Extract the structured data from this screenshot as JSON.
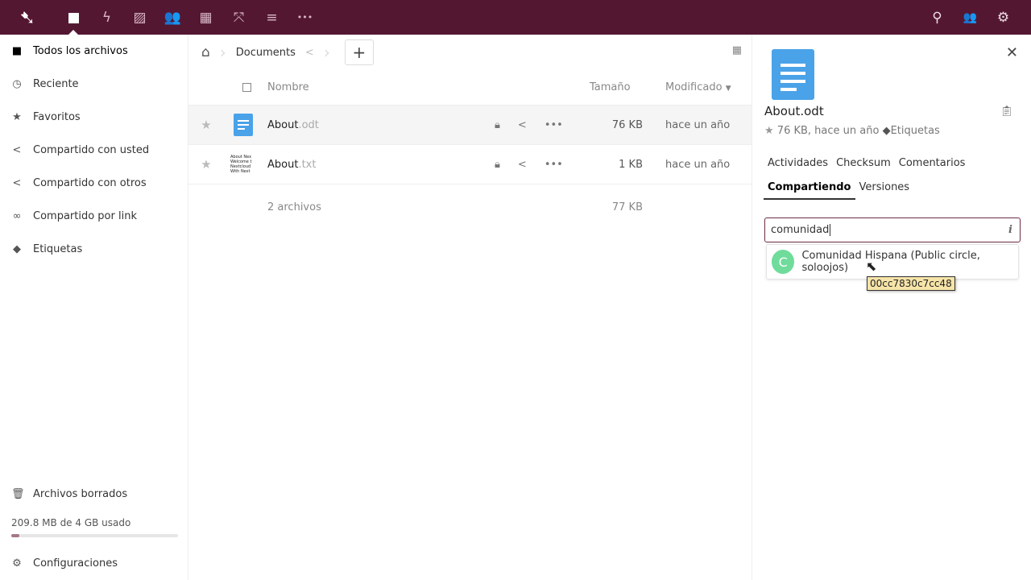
{
  "topbar": {
    "apps": [
      {
        "name": "files",
        "icon": "■"
      },
      {
        "name": "activity",
        "icon": "ϟ"
      },
      {
        "name": "gallery",
        "icon": "▨"
      },
      {
        "name": "contacts",
        "icon": "👥"
      },
      {
        "name": "calendar",
        "icon": "▦"
      },
      {
        "name": "circles",
        "icon": "⤧"
      },
      {
        "name": "notes",
        "icon": "≡"
      },
      {
        "name": "more",
        "icon": "•••"
      }
    ],
    "right": [
      {
        "name": "search",
        "icon": "⚲"
      },
      {
        "name": "contacts-menu",
        "icon": "👥"
      },
      {
        "name": "settings",
        "icon": "⚙"
      }
    ]
  },
  "sidebar": {
    "items": [
      {
        "label": "Todos los archivos",
        "icon": "■"
      },
      {
        "label": "Reciente",
        "icon": "◷"
      },
      {
        "label": "Favoritos",
        "icon": "★"
      },
      {
        "label": "Compartido con usted",
        "icon": "<"
      },
      {
        "label": "Compartido con otros",
        "icon": "<"
      },
      {
        "label": "Compartido por link",
        "icon": "∞"
      },
      {
        "label": "Etiquetas",
        "icon": "◆"
      }
    ],
    "deleted": "Archivos borrados",
    "quota": "209.8 MB de 4 GB usado",
    "quota_percent": 5,
    "settings": "Configuraciones"
  },
  "breadcrumb": {
    "home": "⌂",
    "folder": "Documents"
  },
  "table": {
    "headers": {
      "name": "Nombre",
      "size": "Tamaño",
      "modified": "Modificado"
    },
    "rows": [
      {
        "name": "About",
        "ext": ".odt",
        "size": "76 KB",
        "modified": "hace un año",
        "thumb_lines": []
      },
      {
        "name": "About",
        "ext": ".txt",
        "size": "1 KB",
        "modified": "hace un año",
        "thumb_lines": [
          "About Nex",
          "Welcome t",
          "Nextcloud",
          "With Next"
        ]
      }
    ],
    "summary": {
      "count": "2 archivos",
      "size": "77 KB"
    }
  },
  "details": {
    "filename": "About.odt",
    "meta": "76 KB, hace un año",
    "tags": "Etiquetas",
    "tabs": [
      "Actividades",
      "Checksum",
      "Comentarios",
      "Compartiendo",
      "Versiones"
    ],
    "active_tab": "Compartiendo",
    "share_input": "comunidad",
    "suggestion": {
      "initial": "C",
      "label": "Comunidad Hispana (Public circle, soloojos)"
    },
    "tooltip": "00cc7830c7cc48"
  }
}
